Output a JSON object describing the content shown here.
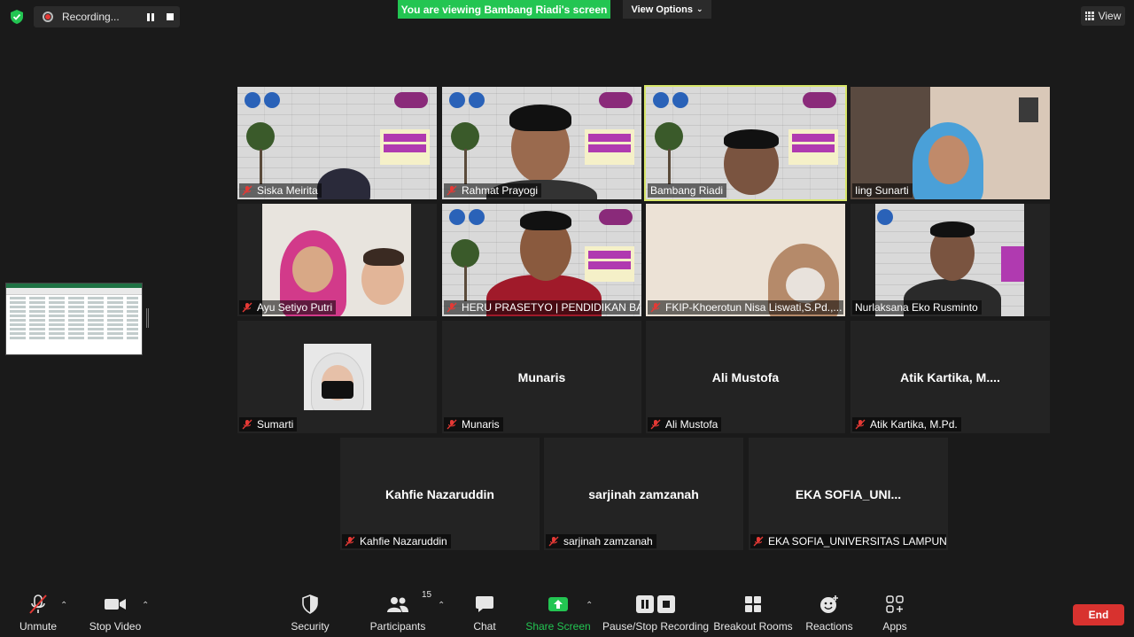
{
  "top": {
    "recording_label": "Recording...",
    "viewing_banner": "You are viewing Bambang Riadi's screen",
    "view_options_label": "View Options",
    "view_label": "View"
  },
  "tiles": [
    {
      "name": "Siska Meirita",
      "video": true
    },
    {
      "name": "Rahmat Prayogi",
      "video": true
    },
    {
      "name": "Bambang Riadi",
      "video": true,
      "active": true
    },
    {
      "name": "Iing Sunarti",
      "video": true,
      "mic_on": true
    },
    {
      "name": "Ayu Setiyo Putri",
      "video": true
    },
    {
      "name": "HERU PRASETYO | PENDIDIKAN BA...",
      "video": true
    },
    {
      "name": "FKIP-Khoerotun Nisa Liswati,S.Pd.,...",
      "video": true
    },
    {
      "name": "Nurlaksana Eko Rusminto",
      "video": true,
      "mic_on": true
    },
    {
      "name": "Sumarti",
      "video": false
    },
    {
      "name": "Munaris",
      "center": "Munaris"
    },
    {
      "name": "Ali Mustofa",
      "center": "Ali Mustofa"
    },
    {
      "name": "Atik Kartika, M.Pd.",
      "center": "Atik Kartika, M...."
    },
    {
      "name": "Kahfie Nazaruddin",
      "center": "Kahfie Nazaruddin"
    },
    {
      "name": "sarjinah zamzanah",
      "center": "sarjinah zamzanah"
    },
    {
      "name": "EKA SOFIA_UNIVERSITAS LAMPUNG",
      "center": "EKA  SOFIA_UNI..."
    }
  ],
  "toolbar": {
    "unmute": "Unmute",
    "stop_video": "Stop Video",
    "security": "Security",
    "participants": "Participants",
    "participants_count": "15",
    "chat": "Chat",
    "share_screen": "Share Screen",
    "pause_stop_recording": "Pause/Stop Recording",
    "breakout_rooms": "Breakout Rooms",
    "reactions": "Reactions",
    "apps": "Apps",
    "end": "End"
  },
  "colors": {
    "share_green": "#23c552",
    "end_red": "#d8322f",
    "active_outline": "#d8e66a",
    "mic_off_red": "#e53935"
  }
}
